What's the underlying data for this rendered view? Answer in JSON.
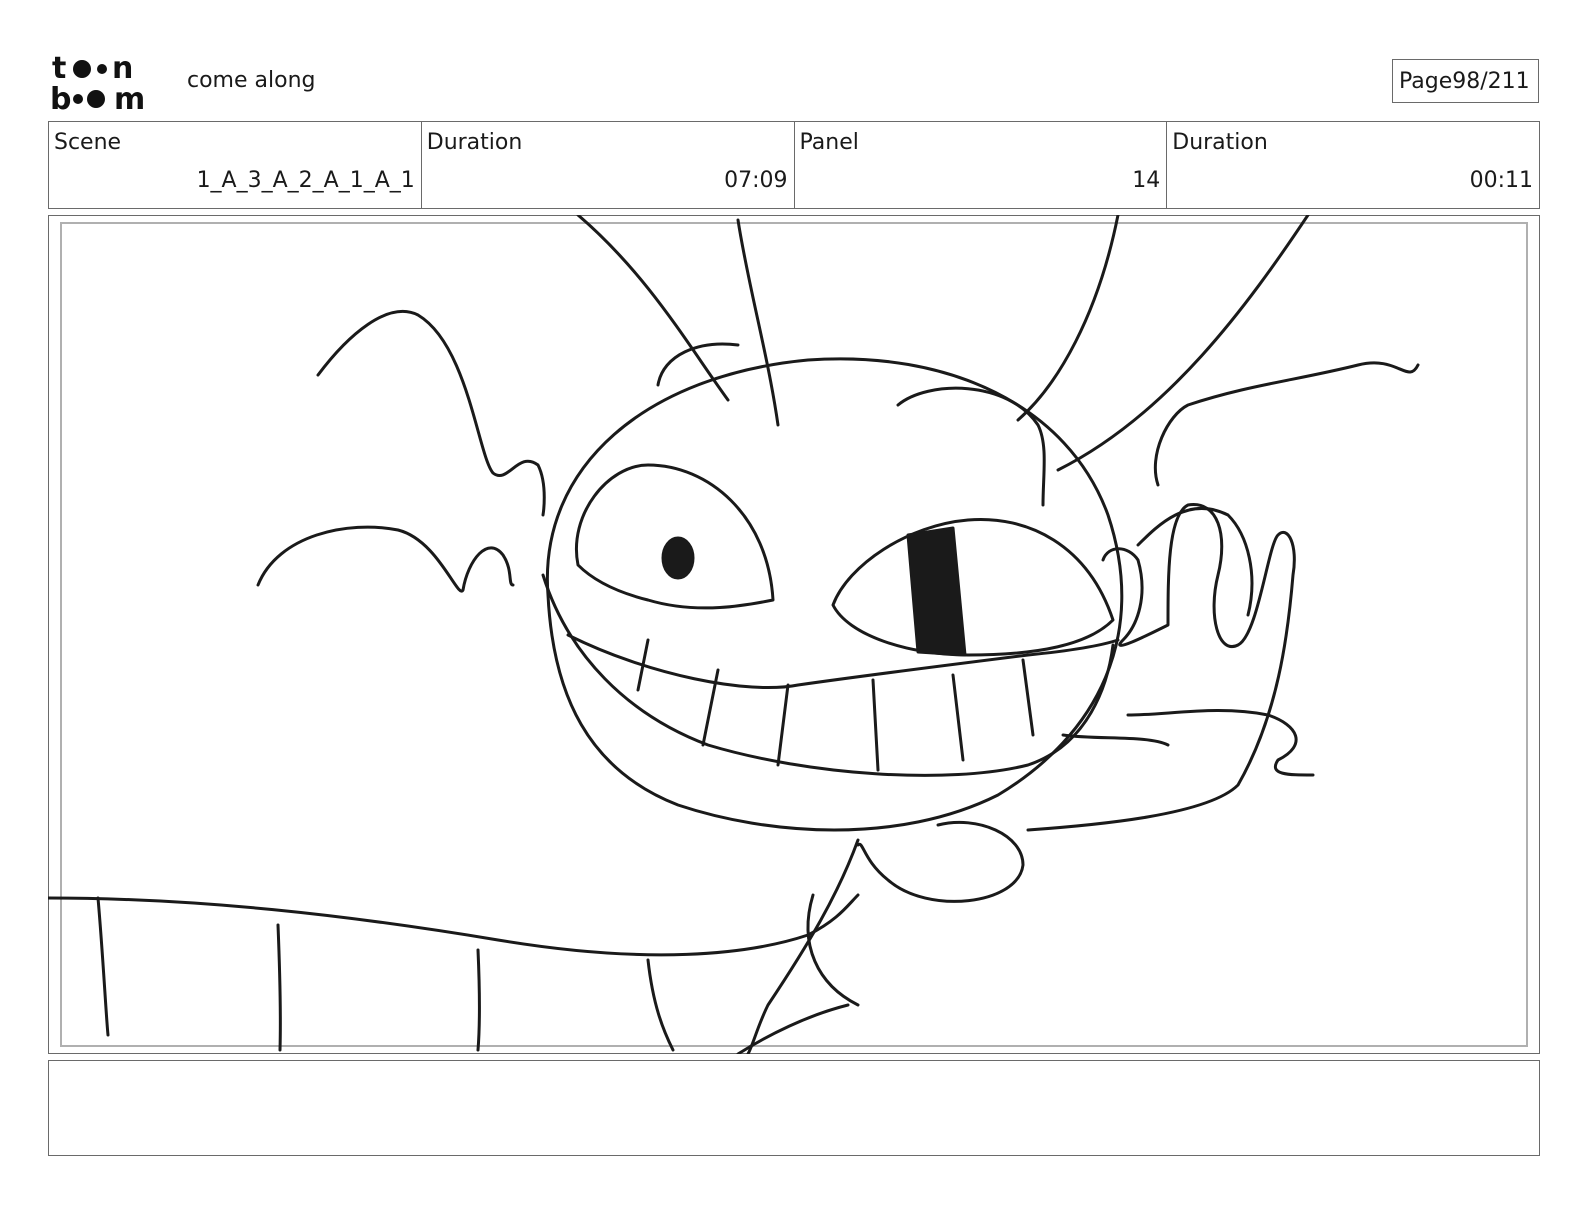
{
  "header": {
    "project_title": "come along",
    "page_label": "Page",
    "page_number": "98/211"
  },
  "info": {
    "scene_label": "Scene",
    "scene_value": "1_A_3_A_2_A_1_A_1",
    "scene_duration_label": "Duration",
    "scene_duration_value": "07:09",
    "panel_label": "Panel",
    "panel_value": "14",
    "panel_duration_label": "Duration",
    "panel_duration_value": "00:11"
  },
  "notes": {
    "text": ""
  }
}
